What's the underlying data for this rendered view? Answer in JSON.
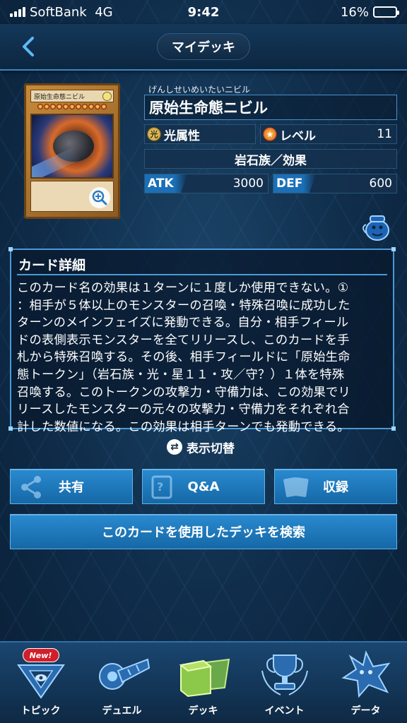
{
  "status_bar": {
    "carrier": "SoftBank",
    "network": "4G",
    "time": "9:42",
    "battery_percent": "16%",
    "battery_level": 0.16
  },
  "header": {
    "title": "マイデッキ",
    "back_icon": "chevron-left-icon"
  },
  "card": {
    "image_name": "原始生命態ニビル",
    "image_attribute_glyph": "光",
    "image_stars": 11,
    "reading": "げんしせいめいたいニビル",
    "name": "原始生命態ニビル",
    "attribute": "光属性",
    "attribute_glyph": "光",
    "level_label": "レベル",
    "level": "11",
    "type": "岩石族／効果",
    "atk_label": "ATK",
    "atk": "3000",
    "def_label": "DEF",
    "def": "600"
  },
  "details": {
    "title": "カード詳細",
    "text": "このカード名の効果は１ターンに１度しか使用できない。①\n：相手が５体以上のモンスターの召喚・特殊召喚に成功した\nターンのメインフェイズに発動できる。自分・相手フィール\nドの表側表示モンスターを全てリリースし、このカードを手\n札から特殊召喚する。その後、相手フィールドに「原始生命\n態トークン」（岩石族・光・星１１・攻／守？）１体を特殊\n召喚する。このトークンの攻撃力・守備力は、この効果でリ\nリースしたモンスターの元々の攻撃力・守備力をそれぞれ合\n計した数値になる。この効果は相手ターンでも発動できる。"
  },
  "actions": {
    "toggle_label": "表示切替",
    "share_label": "共有",
    "qa_label": "Q&A",
    "collection_label": "収録",
    "search_label": "このカードを使用したデッキを検索"
  },
  "bottom_nav": {
    "badge": "New!",
    "items": [
      {
        "label": "トピック",
        "icon": "topic-icon"
      },
      {
        "label": "デュエル",
        "icon": "duel-disk-icon"
      },
      {
        "label": "デッキ",
        "icon": "deck-icon"
      },
      {
        "label": "イベント",
        "icon": "trophy-icon"
      },
      {
        "label": "データ",
        "icon": "data-monster-icon"
      }
    ]
  },
  "colors": {
    "accent": "#1b6fb6",
    "border": "#4a9ad8",
    "badge": "#d21e2a",
    "battery": "#f5c518"
  }
}
